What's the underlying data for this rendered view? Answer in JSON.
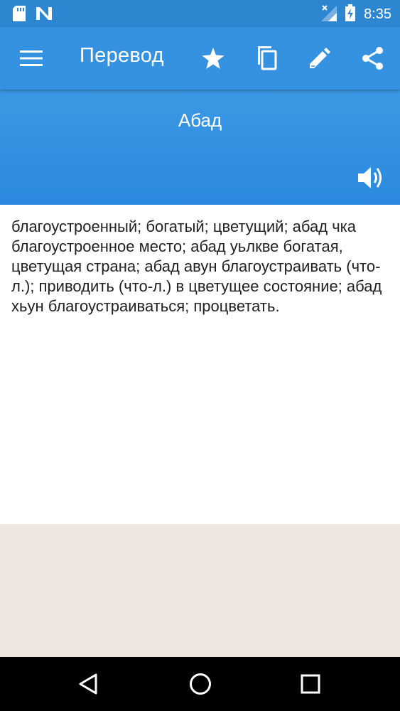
{
  "status_bar": {
    "time": "8:35",
    "left_icons": [
      "sd-card-icon",
      "n-notification-icon"
    ],
    "right_icons": [
      "signal-icon",
      "battery-charging-icon"
    ]
  },
  "toolbar": {
    "title": "Перевод",
    "icons": [
      "menu-icon",
      "star-icon",
      "copy-icon",
      "edit-icon",
      "share-icon"
    ]
  },
  "entry": {
    "word": "Абад",
    "translation": "благоустроенный; богатый; цветущий; абад чка благоустроенное место; абад уьлкве богатая, цветущая страна; абад авун благоустраивать (что-л.); приводить (что-л.) в цветущее состояние; абад хьун благоустраиваться; процветать."
  },
  "colors": {
    "primary": "#3592e0",
    "status_bar": "#2e86d1",
    "ad_background": "#efe6e0",
    "nav_bar": "#000000"
  }
}
